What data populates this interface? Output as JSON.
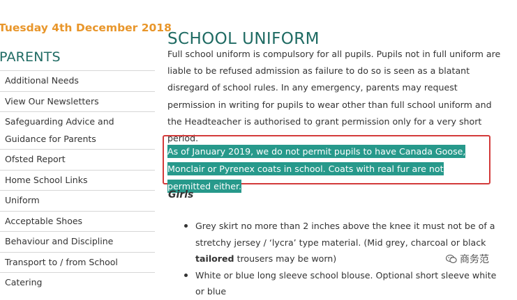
{
  "date": "Tuesday 4th December 2018",
  "sidebar": {
    "heading": "PARENTS",
    "items": [
      "Additional Needs",
      "View Our Newsletters",
      "Safeguarding Advice and Guidance for Parents",
      "Ofsted Report",
      "Home School Links",
      "Uniform",
      "Acceptable Shoes",
      "Behaviour and Discipline",
      "Transport to / from School",
      "Catering"
    ]
  },
  "main": {
    "title": "SCHOOL UNIFORM",
    "intro": "Full school uniform is compulsory for all pupils.  Pupils not in full uniform are liable to be refused admission as failure to do so is seen as a blatant disregard of school rules.  In any emergency, parents may request permission in writing for pupils to wear other than full school uniform and the Headteacher is authorised to grant permission only for a very short period.",
    "highlight": "As of January 2019, we do not permit pupils to have Canada Goose, Monclair or Pyrenex coats in school. Coats with real fur are not permitted either.",
    "girls_heading": "Girls",
    "bullets": [
      {
        "before": "Grey skirt no more than 2 inches above the knee it must not be of a stretchy jersey / ‘lycra’ type material. (Mid grey, charcoal or black ",
        "bold": "tailored",
        "after": " trousers may be worn)"
      },
      {
        "before": "White or blue long sleeve school blouse. Optional short sleeve white or blue",
        "bold": "",
        "after": ""
      }
    ]
  },
  "watermark": {
    "text": "商务范",
    "icon": "wechat-icon"
  },
  "colors": {
    "date": "#e8962b",
    "heading": "#1f6b63",
    "highlight_bg": "#27998b",
    "highlight_border": "#d33a3a"
  }
}
